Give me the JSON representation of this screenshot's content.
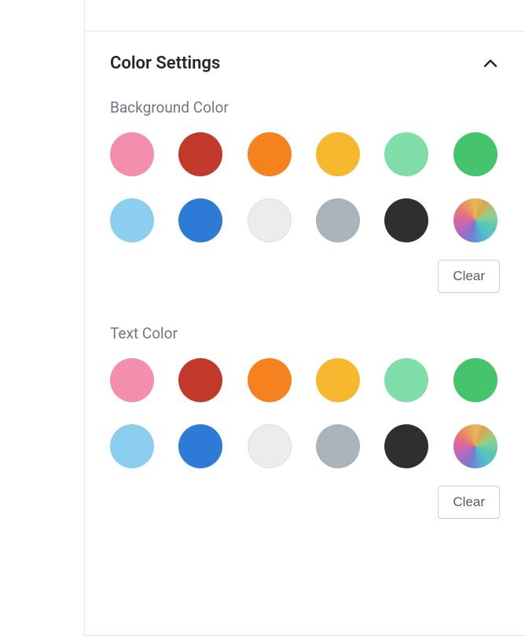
{
  "panel": {
    "title": "Color Settings",
    "expanded": true
  },
  "sections": {
    "background": {
      "label": "Background Color",
      "clear_label": "Clear"
    },
    "text": {
      "label": "Text Color",
      "clear_label": "Clear"
    }
  },
  "palette": [
    {
      "name": "pink",
      "hex": "#f28fab"
    },
    {
      "name": "red",
      "hex": "#c0392b"
    },
    {
      "name": "orange",
      "hex": "#f5821f"
    },
    {
      "name": "amber",
      "hex": "#f5b82e"
    },
    {
      "name": "mint",
      "hex": "#7fdda9"
    },
    {
      "name": "green",
      "hex": "#45c46d"
    },
    {
      "name": "light-blue",
      "hex": "#8cceee"
    },
    {
      "name": "blue",
      "hex": "#2d7bd6"
    },
    {
      "name": "light-gray",
      "hex": "#ececec"
    },
    {
      "name": "gray",
      "hex": "#a8b3ba"
    },
    {
      "name": "black",
      "hex": "#2f2f2f"
    },
    {
      "name": "custom",
      "hex": null
    }
  ]
}
